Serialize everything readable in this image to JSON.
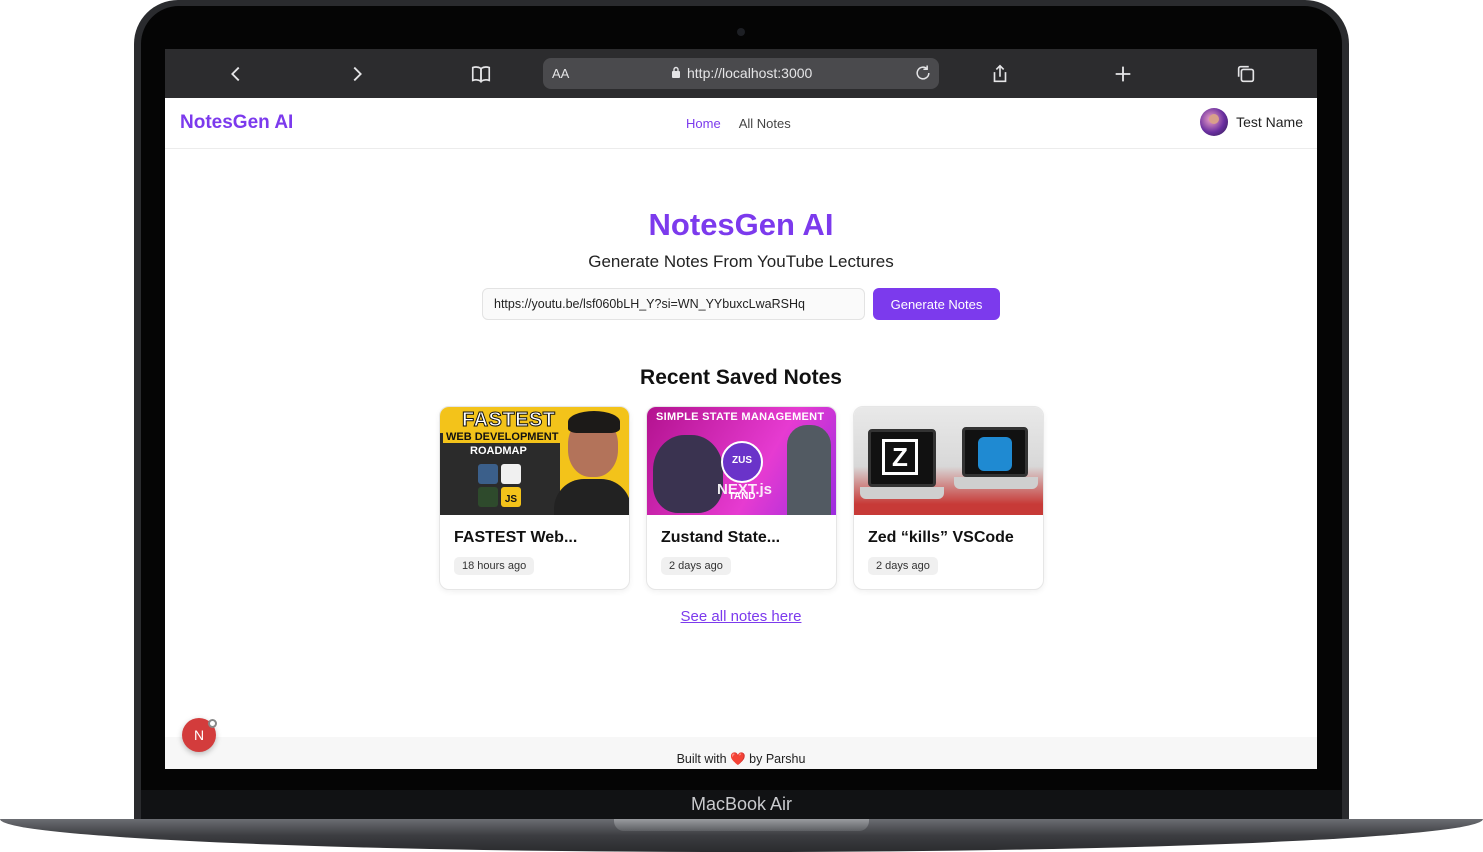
{
  "device": {
    "model": "MacBook Air"
  },
  "browser": {
    "aa_label": "AA",
    "url": "http://localhost:3000"
  },
  "header": {
    "brand": "NotesGen AI",
    "nav": [
      {
        "label": "Home"
      },
      {
        "label": "All Notes"
      }
    ],
    "user_name": "Test Name"
  },
  "hero": {
    "title": "NotesGen AI",
    "subtitle": "Generate Notes From YouTube Lectures",
    "input_value": "https://youtu.be/lsf060bLH_Y?si=WN_YYbuxcLwaRSHq",
    "button_label": "Generate Notes"
  },
  "recent": {
    "title": "Recent Saved Notes",
    "cards": [
      {
        "title": "FASTEST Web...",
        "time": "18 hours ago",
        "thumb_text": [
          "FASTEST",
          "WEB DEVELOPMENT",
          "ROADMAP",
          "JS"
        ]
      },
      {
        "title": "Zustand State...",
        "time": "2 days ago",
        "thumb_text": [
          "SIMPLE STATE MANAGEMENT",
          "ZUS TAND",
          "NEXT.js"
        ]
      },
      {
        "title": "Zed “kills” VSCode",
        "time": "2 days ago",
        "thumb_text": [
          "Z"
        ]
      }
    ],
    "see_all": "See all notes here"
  },
  "footer": {
    "prefix": "Built with",
    "heart": "❤️",
    "suffix": "by Parshu"
  },
  "dev_badge": {
    "letter": "N"
  },
  "colors": {
    "accent": "#7c3aed"
  }
}
